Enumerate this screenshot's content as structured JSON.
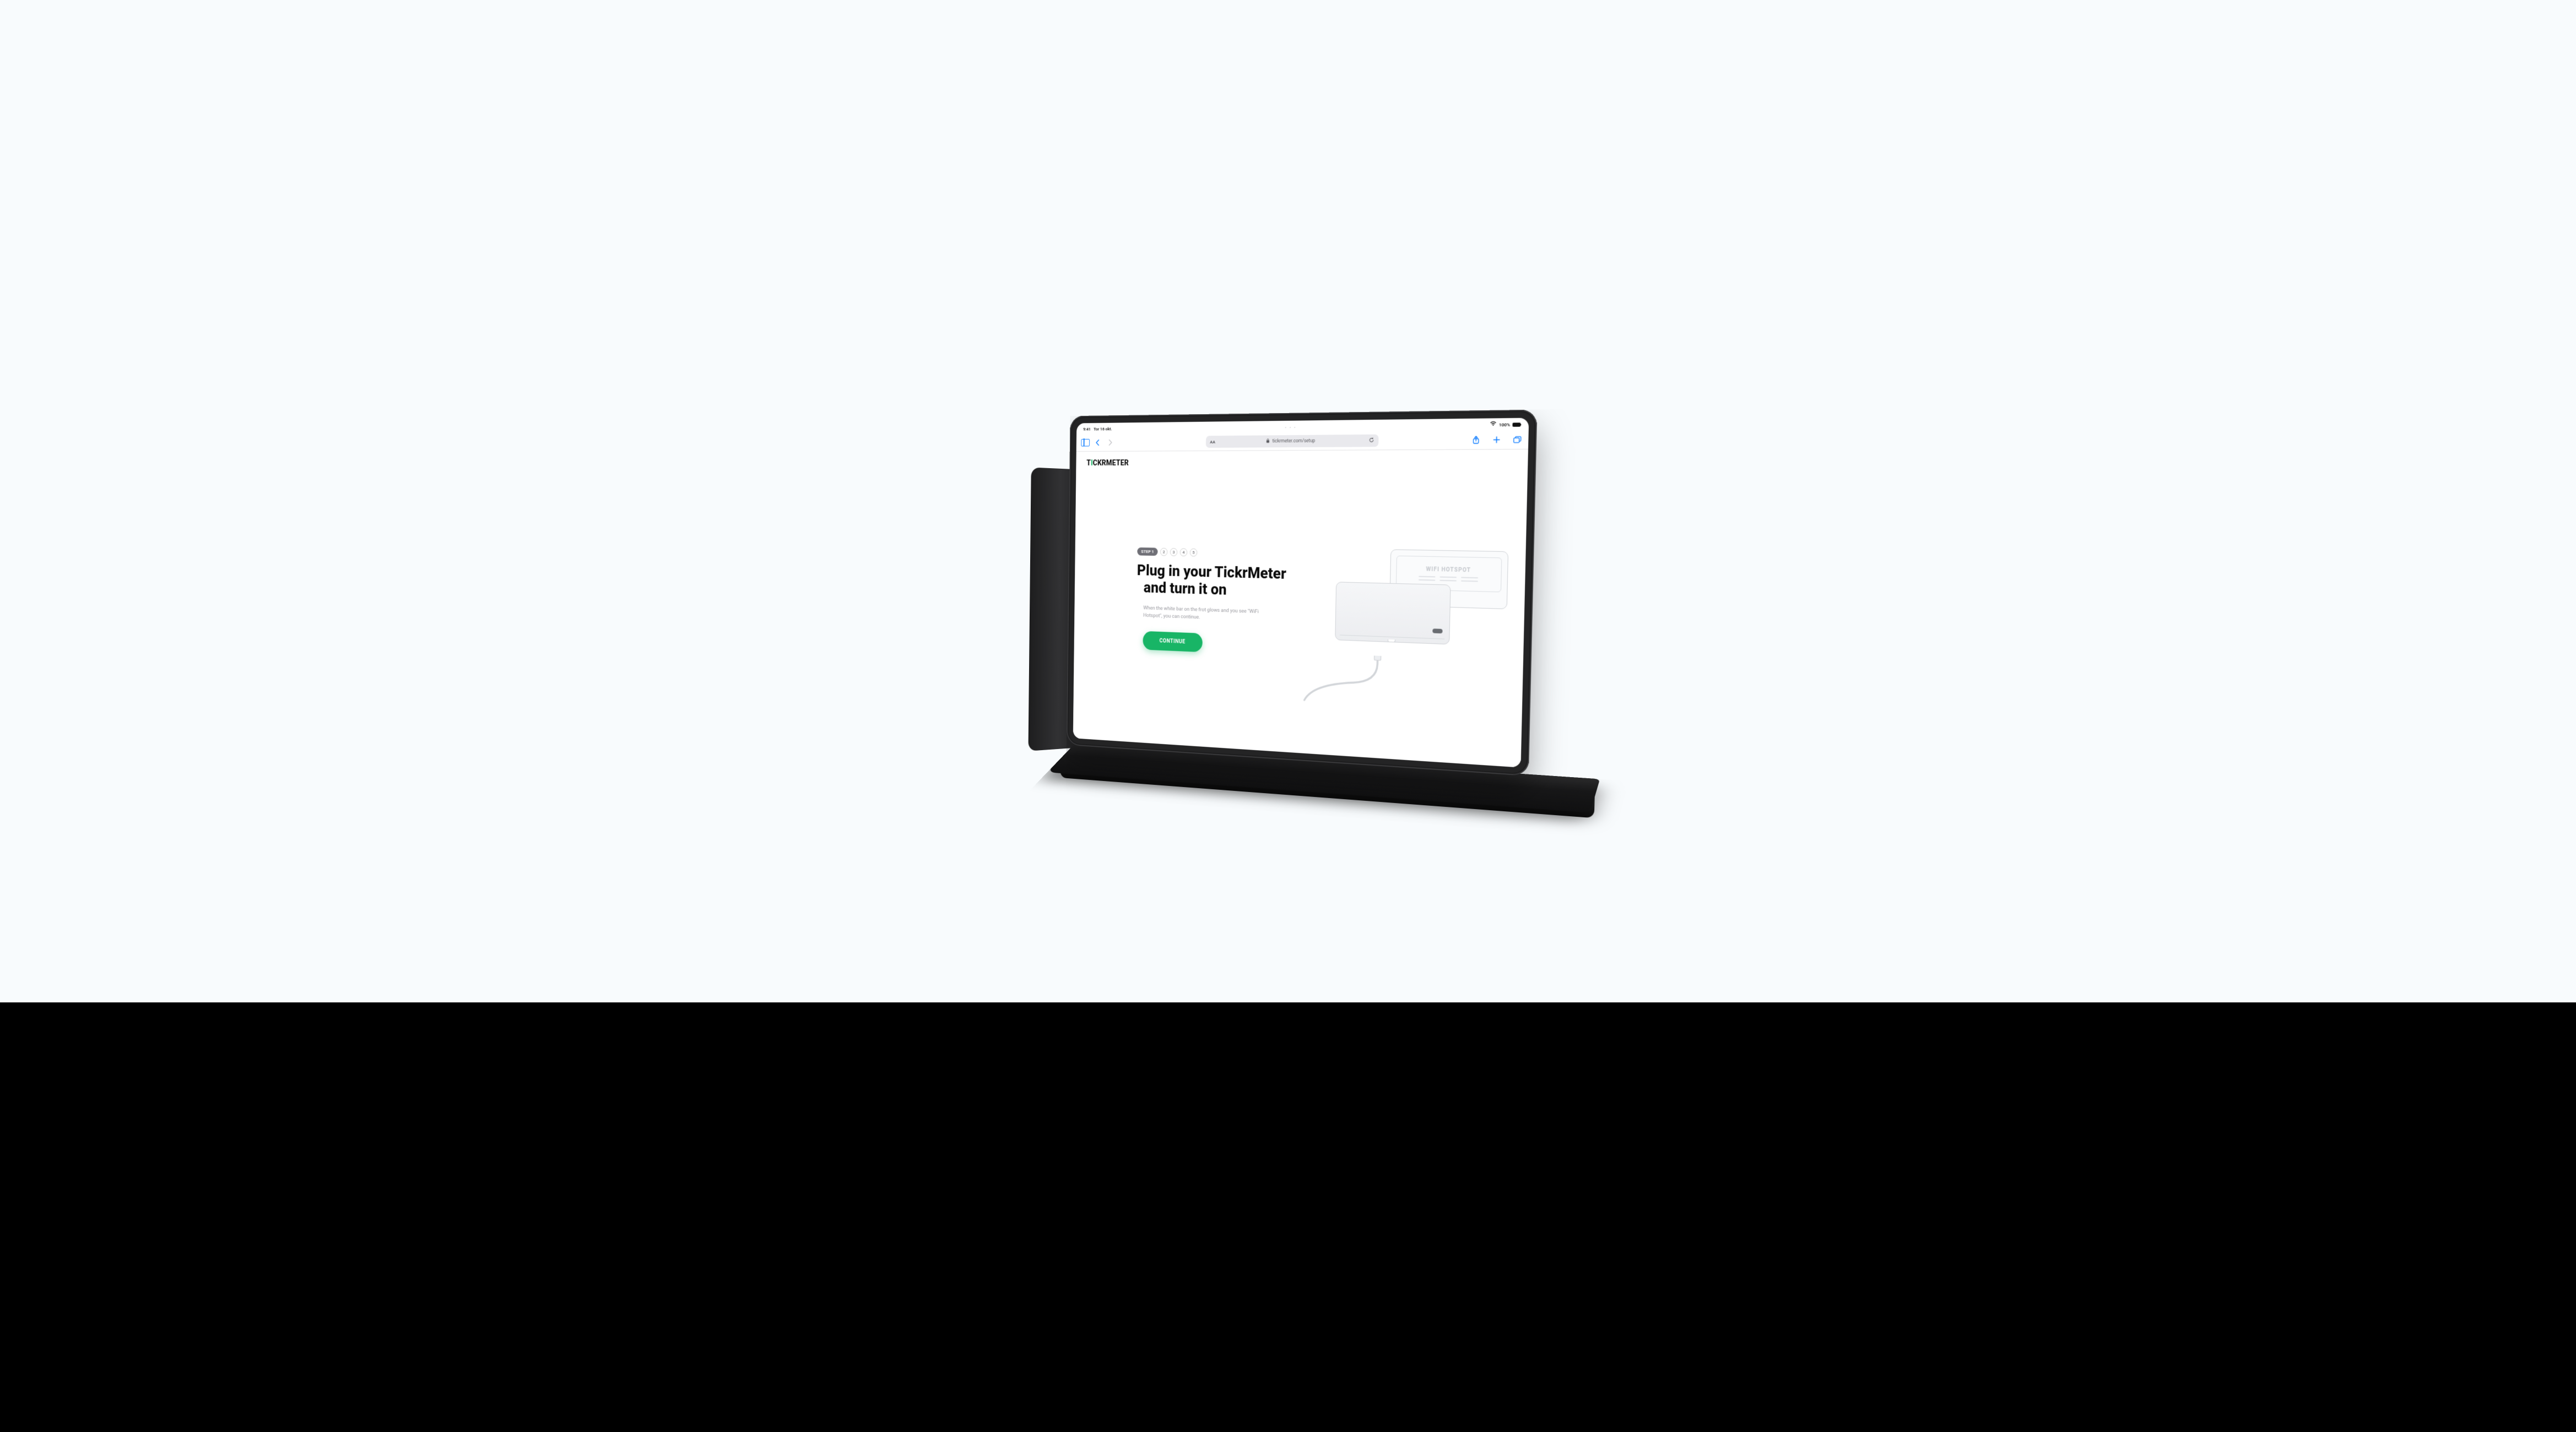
{
  "status": {
    "time": "9:41",
    "date": "Tor 16 okt.",
    "battery_pct": "100%"
  },
  "safari": {
    "aa": "AA",
    "url": "tickrmeter.com/setup",
    "multitask_dots": "• • •"
  },
  "brand": {
    "pre": "T",
    "accent": "I",
    "post": "CKRMETER"
  },
  "steps": {
    "active_label": "STEP 1",
    "others": [
      "2",
      "3",
      "4",
      "5"
    ]
  },
  "headline": {
    "line1": "Plug in your TickrMeter",
    "line2": "and turn it on"
  },
  "description": "When the white bar on the frot glows and you see \"WiFi Hotspot\", you can continue.",
  "cta_label": "CONTINUE",
  "illustration": {
    "hotspot_label": "WIFI HOTSPOT"
  }
}
